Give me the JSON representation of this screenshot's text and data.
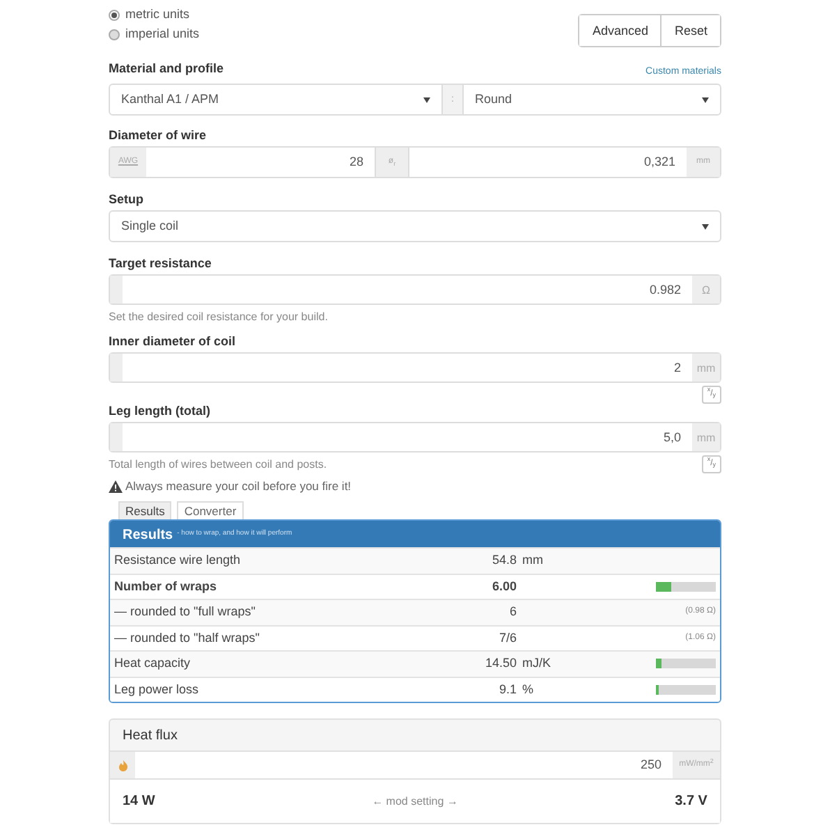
{
  "units": [
    {
      "label": "metric units",
      "selected": true
    },
    {
      "label": "imperial units",
      "selected": false
    }
  ],
  "buttons": [
    "Advanced",
    "Reset"
  ],
  "material": {
    "label": "Material and profile",
    "link": "Custom materials",
    "material": "Kanthal A1 / APM",
    "separator": ":",
    "profile": "Round"
  },
  "diameter": {
    "label": "Diameter of wire",
    "awg_addon": "AWG",
    "awg_value": "28",
    "dia_addon": "ø$_{r}$",
    "dia_value": "0,321",
    "unit": "mm"
  },
  "setup": {
    "label": "Setup",
    "value": "Single coil"
  },
  "target": {
    "label": "Target resistance",
    "value": "0.982",
    "unit": "Ω",
    "help": "Set the desired coil resistance for your build."
  },
  "inner": {
    "label": "Inner diameter of coil",
    "value": "2",
    "unit": "mm",
    "toggle": "$^{x}$/$_{y}$"
  },
  "leg": {
    "label": "Leg length (total)",
    "value": "5,0",
    "unit": "mm",
    "help": "Total length of wires between coil and posts.",
    "toggle": "$^{x}$/$_{y}$"
  },
  "warning": "Always measure your coil before you fire it!",
  "tabs": [
    {
      "label": "Results",
      "selected": true
    },
    {
      "label": "Converter",
      "selected": false
    }
  ],
  "results": {
    "title": "Results",
    "subtitle": "- how to wrap, and how it will perform",
    "rows": [
      {
        "label": "Resistance wire length",
        "value": "54.8",
        "unit": "mm",
        "bold": false,
        "kind": "plain"
      },
      {
        "label": "Number of wraps",
        "value": "6.00",
        "bold": true,
        "kind": "bar",
        "level": 0.25
      },
      {
        "label": "— rounded to \"full wraps\"",
        "value": "6",
        "bold": false,
        "kind": "note",
        "note": "(0.98 Ω)"
      },
      {
        "label": "— rounded to \"half wraps\"",
        "value": "7/6",
        "bold": false,
        "kind": "note",
        "note": "(1.06 Ω)"
      },
      {
        "label": "Heat capacity",
        "value": "14.50",
        "unit": "mJ/K",
        "bold": false,
        "kind": "bar",
        "level": 0.1
      },
      {
        "label": "Leg power loss",
        "value": "9.1",
        "unit": "%",
        "bold": false,
        "kind": "bar",
        "level": 0.05
      }
    ]
  },
  "heat_flux": {
    "title": "Heat flux",
    "value": "250",
    "unit": "mW/mm$^{2}$",
    "power": "14 W",
    "middle": "← mod setting →",
    "voltage": "3.7 V"
  }
}
